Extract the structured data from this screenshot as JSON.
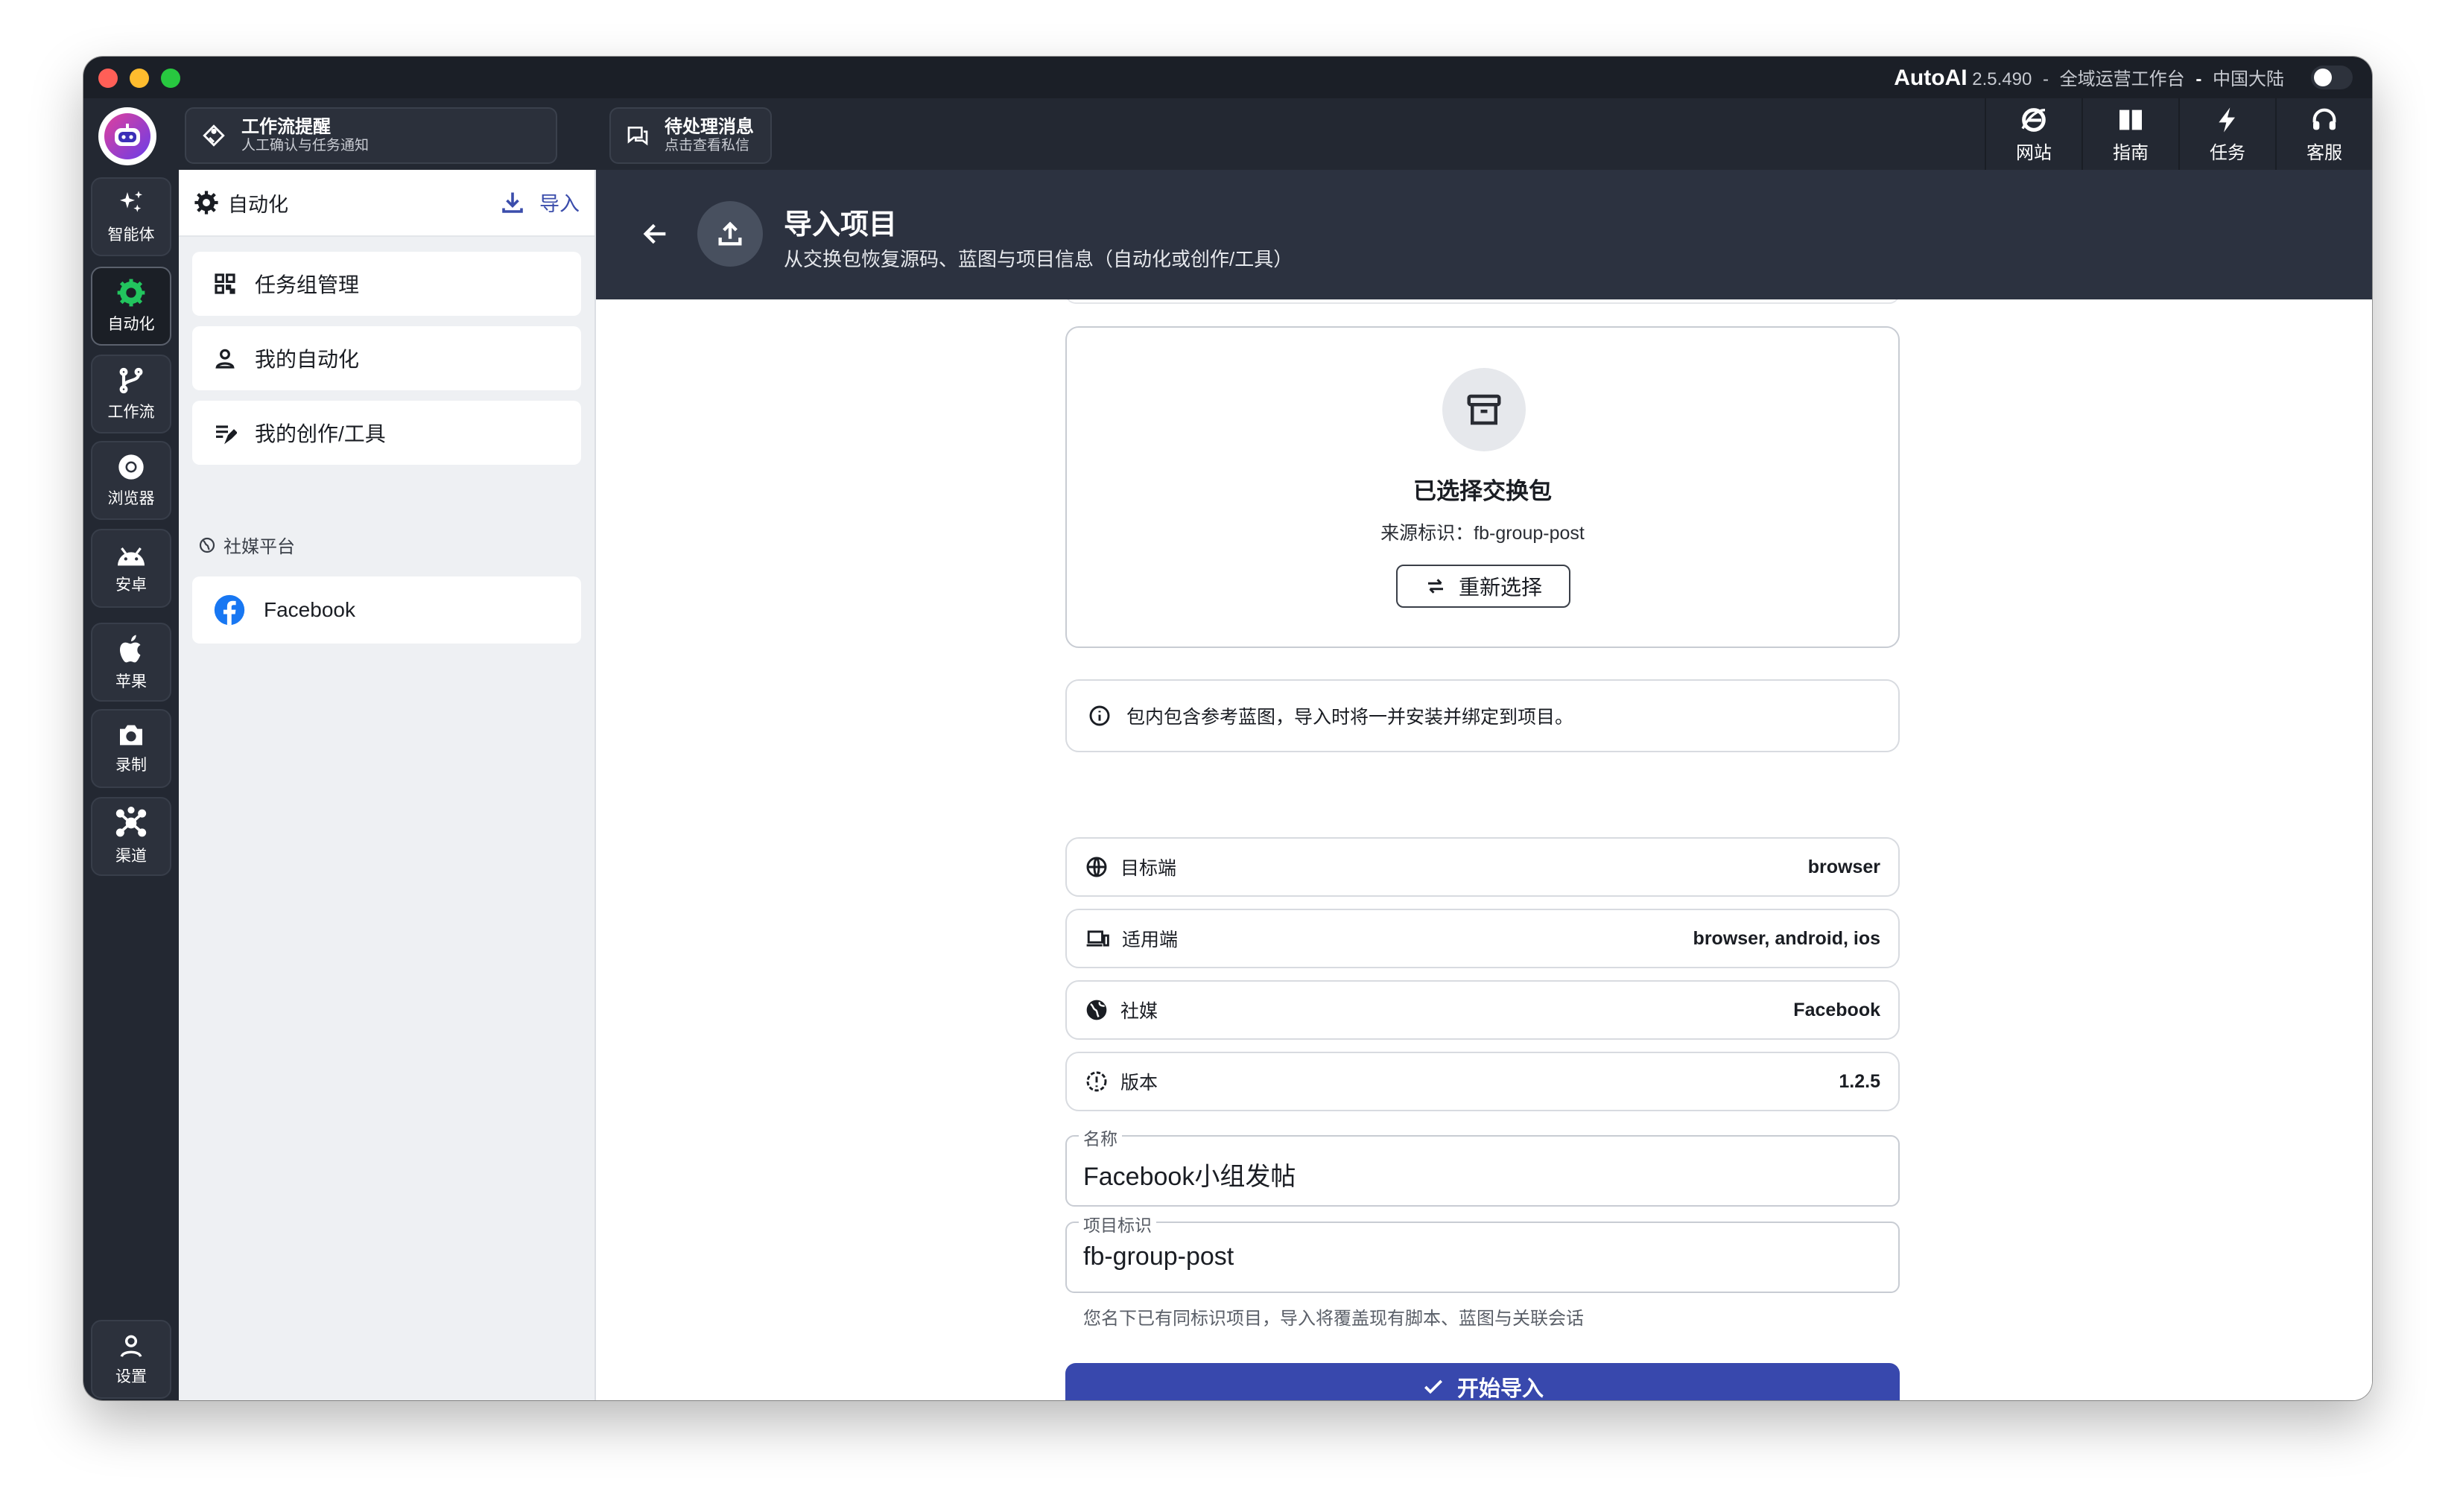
{
  "titlebar": {
    "app_name": "AutoAI",
    "version": "2.5.490",
    "dash": "-",
    "workspace": "全域运营工作台",
    "sep": "-",
    "region": "中国大陆"
  },
  "header": {
    "workflow_alert": {
      "title": "工作流提醒",
      "subtitle": "人工确认与任务通知"
    },
    "pending_messages": {
      "title": "待处理消息",
      "subtitle": "点击查看私信"
    },
    "right_items": [
      {
        "label": "网站",
        "icon": "ie-icon"
      },
      {
        "label": "指南",
        "icon": "book-icon"
      },
      {
        "label": "任务",
        "icon": "bolt-icon"
      },
      {
        "label": "客服",
        "icon": "headset-icon"
      }
    ]
  },
  "rail": {
    "items": [
      {
        "label": "智能体",
        "icon": "sparkle-icon"
      },
      {
        "label": "自动化",
        "icon": "gear-icon",
        "active": true
      },
      {
        "label": "工作流",
        "icon": "branch-icon"
      },
      {
        "label": "浏览器",
        "icon": "chrome-icon"
      },
      {
        "label": "安卓",
        "icon": "android-icon"
      },
      {
        "label": "苹果",
        "icon": "apple-icon"
      },
      {
        "label": "录制",
        "icon": "camera-icon"
      },
      {
        "label": "渠道",
        "icon": "hub-icon"
      }
    ],
    "settings_label": "设置"
  },
  "sidebar": {
    "title": "自动化",
    "import_label": "导入",
    "items": [
      {
        "label": "任务组管理"
      },
      {
        "label": "我的自动化"
      },
      {
        "label": "我的创作/工具"
      }
    ],
    "section_label": "社媒平台",
    "platforms": [
      {
        "label": "Facebook"
      }
    ]
  },
  "main": {
    "title": "导入项目",
    "subtitle": "从交换包恢复源码、蓝图与项目信息（自动化或创作/工具）",
    "package": {
      "title": "已选择交换包",
      "source_prefix": "来源标识：",
      "source_value": "fb-group-post",
      "reselect_label": "重新选择"
    },
    "info_text": "包内包含参考蓝图，导入时将一并安装并绑定到项目。",
    "props": [
      {
        "label": "目标端",
        "value": "browser",
        "icon": "globe-icon"
      },
      {
        "label": "适用端",
        "value": "browser, android, ios",
        "icon": "devices-icon"
      },
      {
        "label": "社媒",
        "value": "Facebook",
        "icon": "globe-icon"
      },
      {
        "label": "版本",
        "value": "1.2.5",
        "icon": "version-icon"
      }
    ],
    "name_field": {
      "label": "名称",
      "value": "Facebook小组发帖"
    },
    "id_field": {
      "label": "项目标识",
      "value": "fb-group-post"
    },
    "hint": "您名下已有同标识项目，导入将覆盖现有脚本、蓝图与关联会话",
    "submit_label": "开始导入"
  },
  "colors": {
    "accent": "#3848ad",
    "header_bg": "#2c3240",
    "rail_bg": "#232832"
  }
}
